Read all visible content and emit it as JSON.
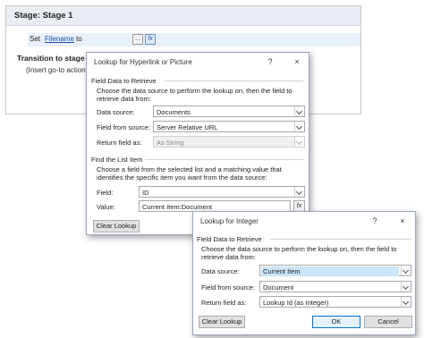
{
  "stage": {
    "title": "Stage: Stage 1",
    "set_prefix": "Set",
    "set_link": "Filename",
    "set_suffix": "to",
    "dots": "...",
    "fx": "fx",
    "transition_title": "Transition to stage",
    "transition_sub": "(Insert go-to action"
  },
  "dialog1": {
    "title": "Lookup for Hyperlink or Picture",
    "help": "?",
    "close": "×",
    "group1_title": "Field Data to Retrieve",
    "group1_desc": "Choose the data source to perform the lookup on, then the field to retrieve data from:",
    "data_source_label": "Data source:",
    "data_source_value": "Documents",
    "field_from_source_label": "Field from source:",
    "field_from_source_value": "Server Relative URL",
    "return_field_label": "Return field as:",
    "return_field_value": "As String",
    "group2_title": "Find the List Item",
    "group2_desc": "Choose a field from the selected list and a matching value that identifies the specific item you want from the data source:",
    "field_label": "Field:",
    "field_value": "ID",
    "value_label": "Value:",
    "value_value": "Current Item:Document",
    "fx": "fx",
    "clear_lookup": "Clear Lookup"
  },
  "dialog2": {
    "title": "Lookup for Integer",
    "help": "?",
    "close": "×",
    "group1_title": "Field Data to Retrieve",
    "group1_desc": "Choose the data source to perform the lookup on, then the field to retrieve data from:",
    "data_source_label": "Data source:",
    "data_source_value": "Current Item",
    "field_from_source_label": "Field from source:",
    "field_from_source_value": "Document",
    "return_field_label": "Return field as:",
    "return_field_value": "Lookup Id (as Integer)",
    "clear_lookup": "Clear Lookup",
    "ok": "OK",
    "cancel": "Cancel"
  },
  "colors": {
    "stage_header": "#e9eef5",
    "set_row_highlight": "#e8f0fb",
    "selection": "#cce4f7",
    "ok_border": "#0078d7"
  }
}
